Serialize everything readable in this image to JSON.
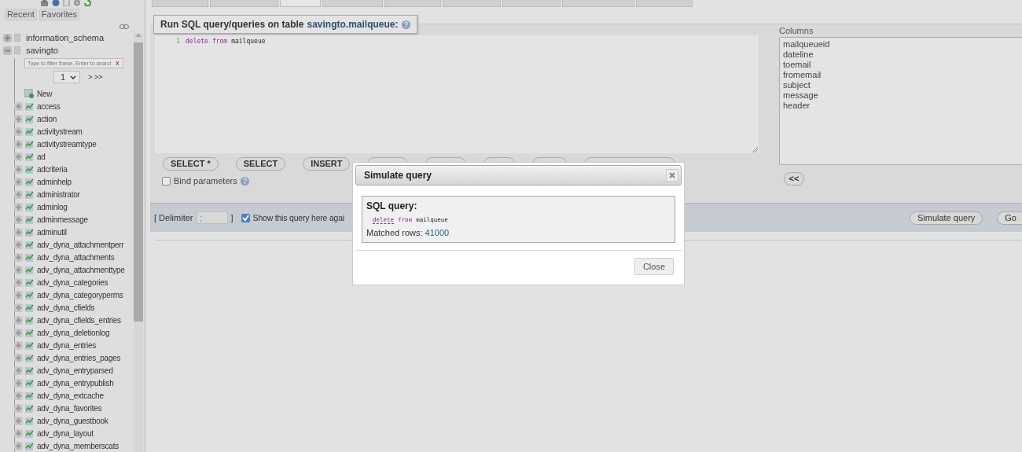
{
  "sidebar": {
    "tabs": [
      {
        "label": "Recent",
        "selected": false
      },
      {
        "label": "Favorites",
        "selected": false
      }
    ],
    "databases": [
      {
        "name": "information_schema",
        "expanded": false
      },
      {
        "name": "savingto",
        "expanded": true,
        "filter": {
          "placeholder": "Type to filter these, Enter to searcl",
          "clear": "X"
        },
        "pager": {
          "value": "1",
          "next": "> >>"
        },
        "children": [
          {
            "name": "New",
            "kind": "new"
          },
          {
            "name": "access",
            "kind": "table"
          },
          {
            "name": "action",
            "kind": "table"
          },
          {
            "name": "activitystream",
            "kind": "table"
          },
          {
            "name": "activitystreamtype",
            "kind": "table"
          },
          {
            "name": "ad",
            "kind": "table"
          },
          {
            "name": "adcriteria",
            "kind": "table"
          },
          {
            "name": "adminhelp",
            "kind": "table"
          },
          {
            "name": "administrator",
            "kind": "table"
          },
          {
            "name": "adminlog",
            "kind": "table"
          },
          {
            "name": "adminmessage",
            "kind": "table"
          },
          {
            "name": "adminutil",
            "kind": "table"
          },
          {
            "name": "adv_dyna_attachmentperr",
            "kind": "table"
          },
          {
            "name": "adv_dyna_attachments",
            "kind": "table"
          },
          {
            "name": "adv_dyna_attachmenttype",
            "kind": "table"
          },
          {
            "name": "adv_dyna_categories",
            "kind": "table"
          },
          {
            "name": "adv_dyna_categoryperms",
            "kind": "table"
          },
          {
            "name": "adv_dyna_cfields",
            "kind": "table"
          },
          {
            "name": "adv_dyna_cfields_entries",
            "kind": "table"
          },
          {
            "name": "adv_dyna_deletionlog",
            "kind": "table"
          },
          {
            "name": "adv_dyna_entries",
            "kind": "table"
          },
          {
            "name": "adv_dyna_entries_pages",
            "kind": "table"
          },
          {
            "name": "adv_dyna_entryparsed",
            "kind": "table"
          },
          {
            "name": "adv_dyna_entrypublish",
            "kind": "table"
          },
          {
            "name": "adv_dyna_extcache",
            "kind": "table"
          },
          {
            "name": "adv_dyna_favorites",
            "kind": "table"
          },
          {
            "name": "adv_dyna_guestbook",
            "kind": "table"
          },
          {
            "name": "adv_dyna_layout",
            "kind": "table"
          },
          {
            "name": "adv_dyna_memberscats",
            "kind": "table"
          }
        ]
      }
    ]
  },
  "top_tabs": [
    {
      "selected": false
    },
    {
      "selected": false
    },
    {
      "selected": true
    },
    {
      "selected": false
    },
    {
      "selected": false
    },
    {
      "selected": false
    },
    {
      "selected": false
    },
    {
      "selected": false
    },
    {
      "selected": false
    }
  ],
  "query_panel": {
    "legend": "Run SQL query/queries on table",
    "table_link": "savingto.mailqueue:",
    "editor": {
      "lines": [
        {
          "number": "1",
          "tokens": [
            {
              "text": "delete",
              "kind": "keyword"
            },
            {
              "text": "from",
              "kind": "keyword"
            },
            {
              "text": "mailqueue",
              "kind": "name"
            }
          ]
        }
      ]
    },
    "buttons": [
      "SELECT *",
      "SELECT",
      "INSERT"
    ],
    "bind_parameters": {
      "label": "Bind parameters",
      "checked": false
    },
    "columns": {
      "label": "Columns",
      "items": [
        "mailqueueid",
        "dateline",
        "toemail",
        "fromemail",
        "subject",
        "message",
        "header"
      ],
      "insert": "<<"
    }
  },
  "footer": {
    "delimiter_label": "[ Delimiter",
    "delimiter_value": ";",
    "close_bracket": "]",
    "show_again": {
      "label": "Show this query here agai",
      "checked": true
    },
    "buttons": [
      "Simulate query",
      "Go"
    ]
  },
  "dialog": {
    "title": "Simulate query",
    "heading": "SQL query:",
    "query": [
      {
        "text": "delete",
        "kind": "keyword"
      },
      {
        "text": "from",
        "kind": "keyword"
      },
      {
        "text": "mailqueue",
        "kind": "name"
      }
    ],
    "matched_label": "Matched rows:",
    "matched_value": "41000",
    "button": "Close"
  }
}
